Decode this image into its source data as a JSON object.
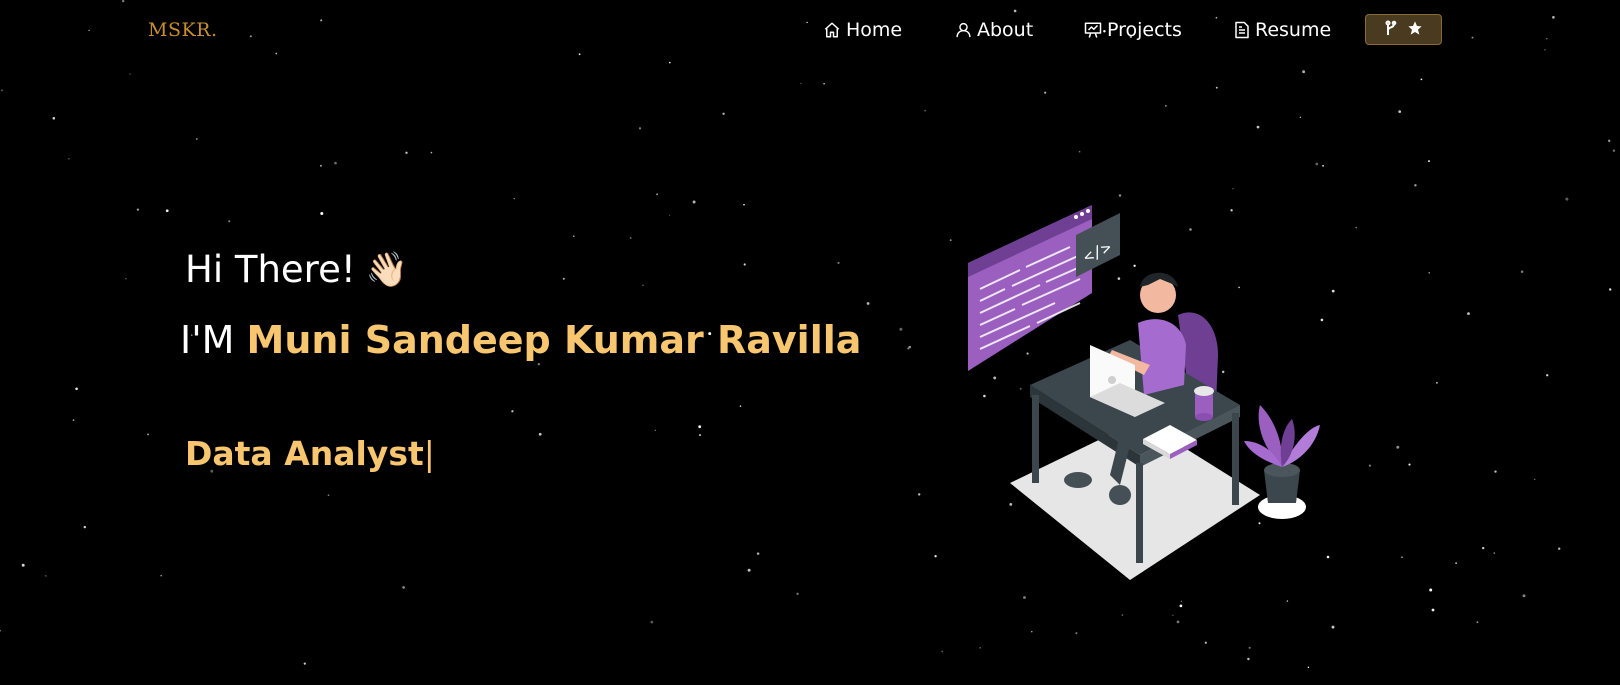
{
  "brand": {
    "logo": "MSKR."
  },
  "nav": {
    "items": [
      {
        "label": "Home",
        "icon": "home-icon"
      },
      {
        "label": "About",
        "icon": "user-icon"
      },
      {
        "label": "Projects",
        "icon": "presentation-icon"
      },
      {
        "label": "Resume",
        "icon": "document-icon"
      }
    ],
    "github_button": {
      "icons": [
        "git-fork-icon",
        "star-icon"
      ]
    }
  },
  "hero": {
    "greeting": "Hi There!",
    "wave_emoji": "👋🏻",
    "intro_prefix": "I'M",
    "name": "Muni Sandeep Kumar Ravilla",
    "role": "Data Analyst",
    "cursor": "|"
  },
  "colors": {
    "background": "#000000",
    "accent": "#f7c66f",
    "logo": "#c98f2e",
    "purple": "#9b5fc0",
    "button_bg": "#4a3a1f"
  }
}
